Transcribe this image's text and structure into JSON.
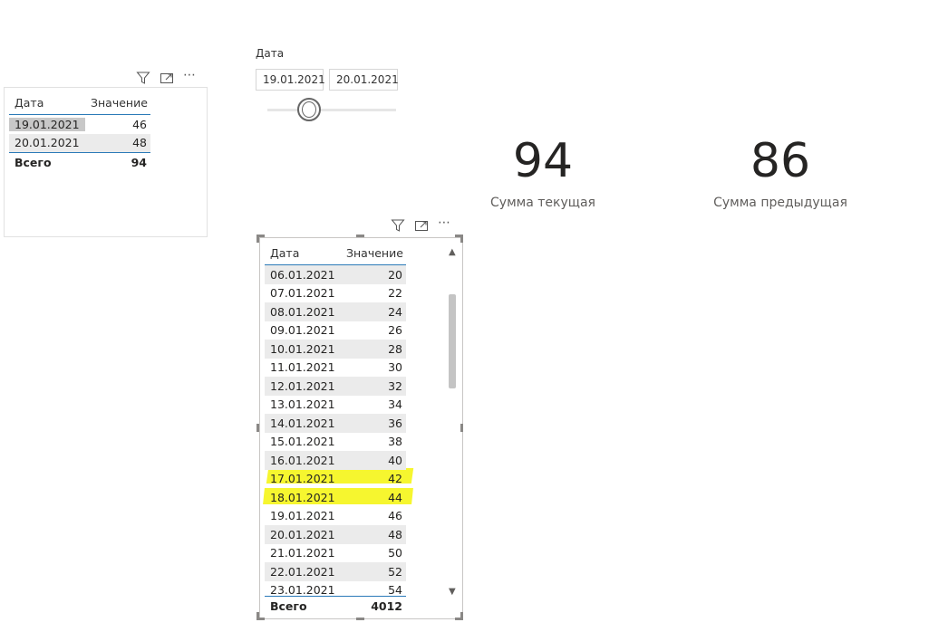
{
  "table1": {
    "col_date": "Дата",
    "col_value": "Значение",
    "rows": [
      {
        "date": "19.01.2021",
        "value": "46"
      },
      {
        "date": "20.01.2021",
        "value": "48"
      }
    ],
    "total_label": "Всего",
    "total_value": "94"
  },
  "slicer": {
    "title": "Дата",
    "start": "19.01.2021",
    "end": "20.01.2021"
  },
  "cards": {
    "current_value": "94",
    "current_label": "Сумма текущая",
    "previous_value": "86",
    "previous_label": "Сумма предыдущая"
  },
  "table2": {
    "col_date": "Дата",
    "col_value": "Значение",
    "rows": [
      {
        "date": "06.01.2021",
        "value": "20"
      },
      {
        "date": "07.01.2021",
        "value": "22"
      },
      {
        "date": "08.01.2021",
        "value": "24"
      },
      {
        "date": "09.01.2021",
        "value": "26"
      },
      {
        "date": "10.01.2021",
        "value": "28"
      },
      {
        "date": "11.01.2021",
        "value": "30"
      },
      {
        "date": "12.01.2021",
        "value": "32"
      },
      {
        "date": "13.01.2021",
        "value": "34"
      },
      {
        "date": "14.01.2021",
        "value": "36"
      },
      {
        "date": "15.01.2021",
        "value": "38"
      },
      {
        "date": "16.01.2021",
        "value": "40"
      },
      {
        "date": "17.01.2021",
        "value": "42"
      },
      {
        "date": "18.01.2021",
        "value": "44"
      },
      {
        "date": "19.01.2021",
        "value": "46"
      },
      {
        "date": "20.01.2021",
        "value": "48"
      },
      {
        "date": "21.01.2021",
        "value": "50"
      },
      {
        "date": "22.01.2021",
        "value": "52"
      },
      {
        "date": "23.01.2021",
        "value": "54"
      }
    ],
    "total_label": "Всего",
    "total_value": "4012"
  },
  "icons": [
    "filter-icon",
    "focus-mode-icon",
    "more-options-icon",
    "scroll-up-icon",
    "scroll-down-icon"
  ],
  "colors": {
    "highlight": "#f4f40a",
    "accent_line": "#2b7ab8",
    "row_alt": "#ebebeb",
    "selected_cell": "#c8c8c8"
  }
}
